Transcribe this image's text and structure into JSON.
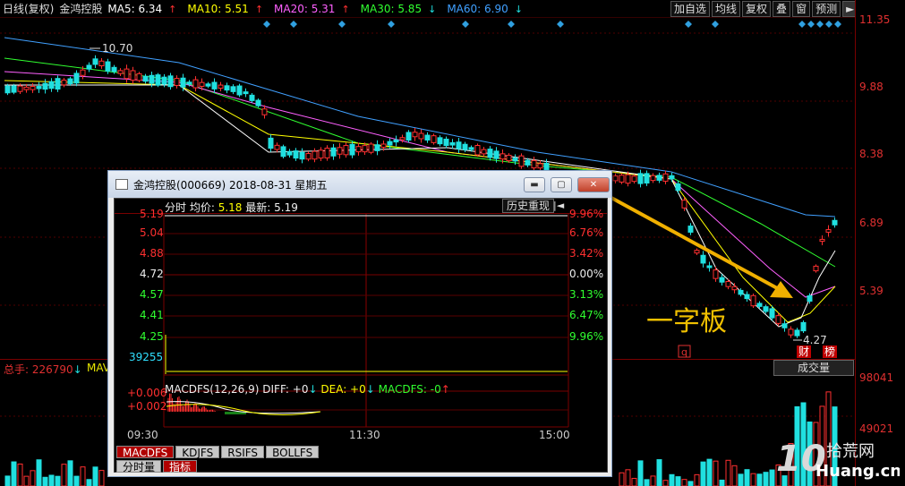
{
  "topbar": {
    "chart_type": "日线(复权)",
    "stock_name": "金鸿控股",
    "ma5": "MA5: 6.34",
    "ma10": "MA10: 5.51",
    "ma20": "MA20: 5.31",
    "ma30": "MA30: 5.85",
    "ma60": "MA60: 6.90",
    "up_arrow": "↑",
    "down_arrow": "↓",
    "buttons": [
      "加自选",
      "均线",
      "复权",
      "叠",
      "窗",
      "预测"
    ],
    "nav_icon": "►|",
    "dropdown_icon": "▼"
  },
  "price_axis": [
    "11.35",
    "9.88",
    "8.38",
    "6.89",
    "5.39"
  ],
  "volume_axis": [
    "98041",
    "49021"
  ],
  "annotations": {
    "high": "10.70",
    "low": "4.27",
    "badge_q": "q",
    "badge_cai": "财",
    "badge_bang": "榜",
    "yizi": "一字板"
  },
  "volume_panel": {
    "total_label": "总手: 226790",
    "ma_label": "MAVO",
    "tag": "成交量"
  },
  "watermark": {
    "number": "10",
    "brand": "拾荒网",
    "domain": "Huang.cn"
  },
  "popup": {
    "title": "金鸿控股(000669)  2018-08-31  星期五",
    "min_btn": "▬",
    "max_btn": "▢",
    "close_btn": "✕",
    "header": {
      "label_fenshi": "分时",
      "avg_label": "均价:",
      "avg_value": "5.18",
      "latest_label": "最新:",
      "latest_value": "5.19",
      "history_btn": "历史重现",
      "history_icon": "|◄"
    },
    "price_levels": [
      "5.19",
      "5.04",
      "4.88",
      "4.72",
      "4.57",
      "4.41",
      "4.25"
    ],
    "pct_levels": [
      "9.96%",
      "6.76%",
      "3.42%",
      "0.00%",
      "3.13%",
      "6.47%",
      "9.96%"
    ],
    "volume_value": "39255",
    "macd": {
      "label": "MACDFS(12,26,9)",
      "diff": "DIFF: +0",
      "dea": "DEA: +0",
      "macdfs": "MACDFS: -0",
      "top_value": "+0.006",
      "mid_value": "+0.002"
    },
    "times": [
      "09:30",
      "11:30",
      "15:00"
    ],
    "indicator_tabs": [
      "MACDFS",
      "KDJFS",
      "RSIFS",
      "BOLLFS"
    ],
    "bottom_tabs": [
      "分时量",
      "指标"
    ]
  },
  "colors": {
    "up": "#ff3030",
    "down": "#20e0e0",
    "ma5": "#ffffff",
    "ma10": "#ffff00",
    "ma20": "#ff60ff",
    "ma30": "#30ff30",
    "ma60": "#40a0ff",
    "arrow": "#f0b000"
  }
}
